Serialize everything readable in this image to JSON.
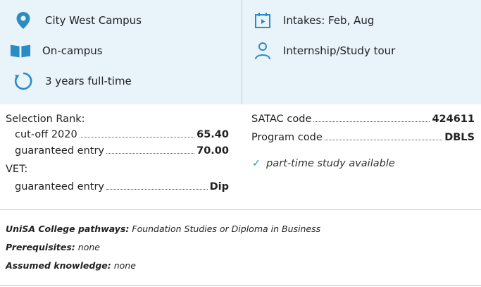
{
  "summary": {
    "campus": "City West Campus",
    "mode": "On-campus",
    "duration": "3 years full-time",
    "intakes": "Intakes: Feb, Aug",
    "internship": "Internship/Study tour"
  },
  "icons": {
    "campus": "map-pin-icon",
    "mode": "open-book-icon",
    "duration": "circular-arrow-icon",
    "intakes": "calendar-icon",
    "internship": "person-icon"
  },
  "accent_color": "#2b8cc4",
  "selection": {
    "heading": "Selection Rank:",
    "cutoff_label": "cut-off 2020",
    "cutoff_value": "65.40",
    "guaranteed_label": "guaranteed entry",
    "guaranteed_value": "70.00",
    "vet_heading": "VET:",
    "vet_guaranteed_label": "guaranteed entry",
    "vet_guaranteed_value": "Dip"
  },
  "codes": {
    "satac_label": "SATAC code",
    "satac_value": "424611",
    "program_label": "Program code",
    "program_value": "DBLS",
    "part_time": "part-time study available",
    "part_time_mark": "✓"
  },
  "notes": {
    "pathways_label": "UniSA College pathways:",
    "pathways_value": "Foundation Studies or Diploma in Business",
    "prereq_label": "Prerequisites:",
    "prereq_value": "none",
    "assumed_label": "Assumed knowledge:",
    "assumed_value": "none"
  }
}
